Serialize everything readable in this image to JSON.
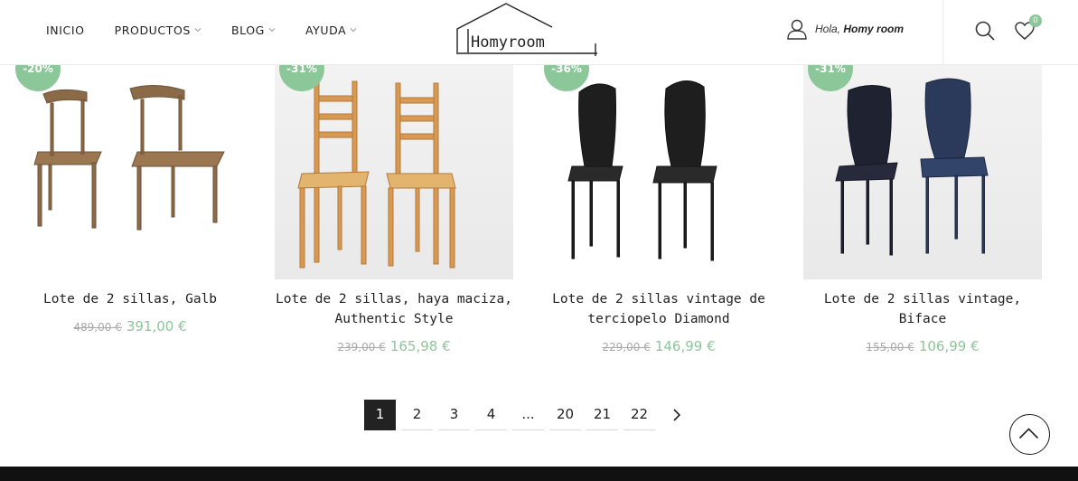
{
  "header": {
    "nav": [
      {
        "label": "INICIO",
        "has_dropdown": false
      },
      {
        "label": "PRODUCTOS",
        "has_dropdown": true
      },
      {
        "label": "BLOG",
        "has_dropdown": true
      },
      {
        "label": "AYUDA",
        "has_dropdown": true
      }
    ],
    "logo_text": "Homyroom",
    "greeting_prefix": "Hola, ",
    "greeting_name": "Homy room",
    "wishlist_count": "0",
    "icons": [
      "user-icon",
      "search-icon",
      "heart-icon"
    ]
  },
  "products": [
    {
      "discount": "-20%",
      "name": "Lote de 2 sillas, Galb",
      "old_price": "489,00 €",
      "new_price": "391,00 €"
    },
    {
      "discount": "-31%",
      "name": "Lote de 2 sillas, haya maciza, Authentic Style",
      "old_price": "239,00 €",
      "new_price": "165,98 €"
    },
    {
      "discount": "-36%",
      "name": "Lote de 2 sillas vintage de terciopelo Diamond",
      "old_price": "229,00 €",
      "new_price": "146,99 €"
    },
    {
      "discount": "-31%",
      "name": "Lote de 2 sillas vintage, Biface",
      "old_price": "155,00 €",
      "new_price": "106,99 €"
    }
  ],
  "pagination": {
    "current": "1",
    "pages": [
      "1",
      "2",
      "3",
      "4",
      "...",
      "20",
      "21",
      "22"
    ],
    "next_icon": "chevron-right-icon"
  },
  "colors": {
    "accent": "#8cc79a",
    "old_price": "#a8a8a8",
    "active_page": "#222222",
    "footer": "#111111"
  }
}
